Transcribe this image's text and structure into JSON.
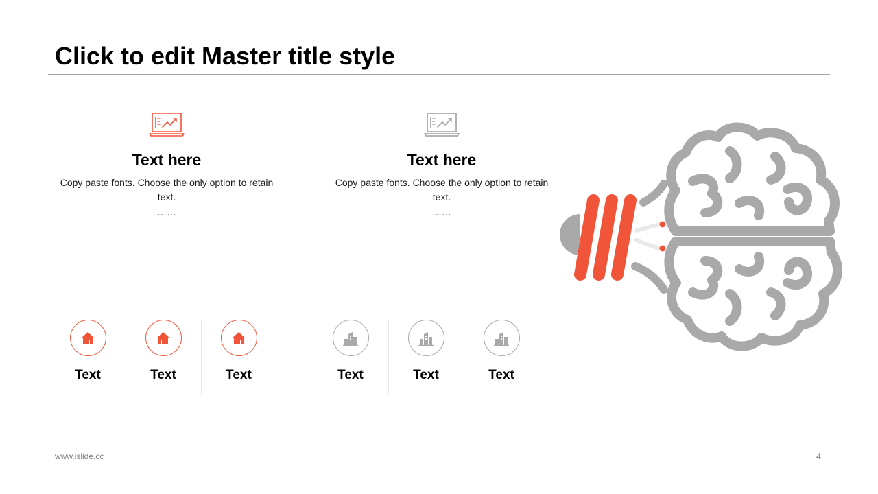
{
  "slide": {
    "title": "Click to edit Master title style",
    "footer_url": "www.islide.cc",
    "page_number": "4"
  },
  "features": [
    {
      "icon": "laptop-chart-icon",
      "color": "#f05539",
      "heading": "Text here",
      "body": "Copy paste fonts. Choose the only option to retain text.",
      "ellipsis": "……"
    },
    {
      "icon": "laptop-chart-icon",
      "color": "#a9a9a9",
      "heading": "Text here",
      "body": "Copy paste fonts. Choose the only option to retain text.",
      "ellipsis": "……"
    }
  ],
  "left_group": {
    "icon": "house-icon",
    "color": "#f05539",
    "items": [
      {
        "label": "Text"
      },
      {
        "label": "Text"
      },
      {
        "label": "Text"
      }
    ]
  },
  "right_group": {
    "icon": "buildings-icon",
    "color": "#a9a9a9",
    "items": [
      {
        "label": "Text"
      },
      {
        "label": "Text"
      },
      {
        "label": "Text"
      }
    ]
  },
  "illustration": {
    "icon": "brain-bulb-icon",
    "colors": {
      "brain": "#a9a9a9",
      "accent": "#f05539"
    }
  }
}
